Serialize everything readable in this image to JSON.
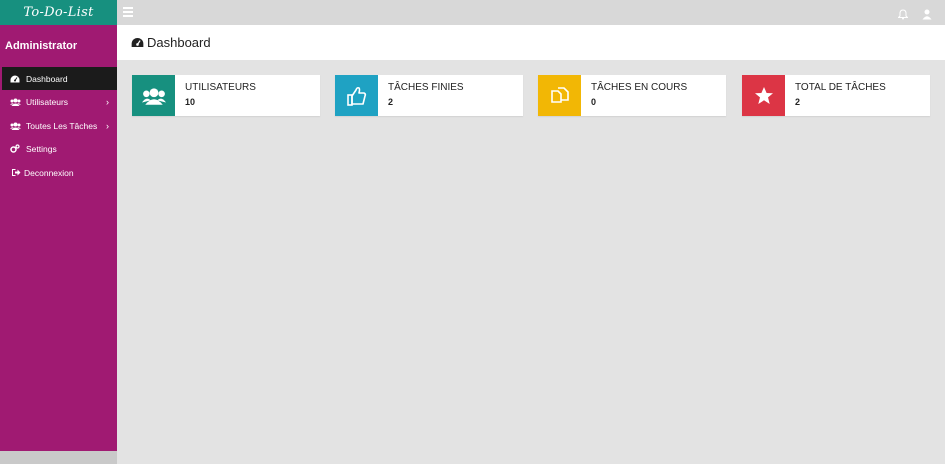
{
  "brand": {
    "title": "To-Do-List"
  },
  "sidebar": {
    "user": "Administrator",
    "items": [
      {
        "label": "Dashboard",
        "active": true,
        "has_chevron": false,
        "icon": "dashboard-icon"
      },
      {
        "label": "Utilisateurs",
        "active": false,
        "has_chevron": true,
        "icon": "users-icon"
      },
      {
        "label": "Toutes Les Tâches",
        "active": false,
        "has_chevron": true,
        "icon": "users-icon"
      },
      {
        "label": "Settings",
        "active": false,
        "has_chevron": false,
        "icon": "gears-icon"
      },
      {
        "label": "Deconnexion",
        "active": false,
        "has_chevron": false,
        "icon": "logout-icon"
      }
    ]
  },
  "topbar": {
    "menu_icon": "hamburger-icon",
    "notification_icon": "bell-icon",
    "user_icon": "user-icon"
  },
  "header": {
    "title": "Dashboard",
    "icon": "dashboard-icon"
  },
  "cards": [
    {
      "title": "UTILISATEURS",
      "value": "10",
      "color": "#17907f",
      "icon": "users-icon"
    },
    {
      "title": "TÂCHES FINIES",
      "value": "2",
      "color": "#1fa2c3",
      "icon": "thumbs-up-icon"
    },
    {
      "title": "TÂCHES EN COURS",
      "value": "0",
      "color": "#f2b705",
      "icon": "copy-icon"
    },
    {
      "title": "TOTAL DE TÂCHES",
      "value": "2",
      "color": "#dc3545",
      "icon": "star-icon"
    }
  ],
  "colors": {
    "brand": "#17907f",
    "sidebar": "#a01a72",
    "active_item": "#1b1b1b",
    "background": "#e3e3e3"
  }
}
